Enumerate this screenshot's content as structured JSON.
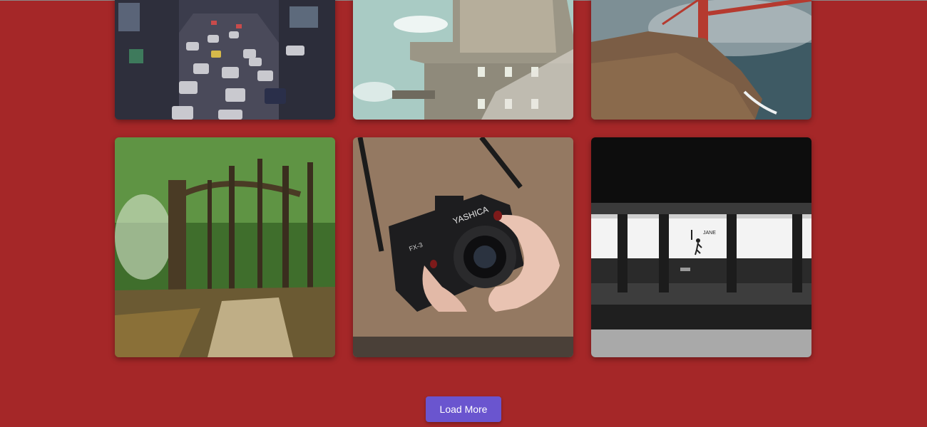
{
  "gallery": {
    "photos": [
      {
        "subject": "city traffic"
      },
      {
        "subject": "concrete tower"
      },
      {
        "subject": "golden gate bridge"
      },
      {
        "subject": "forest path"
      },
      {
        "subject": "camera in hands",
        "camera_text": "YASHICA",
        "model_text": "FX-3"
      },
      {
        "subject": "subway platform",
        "sign_text": "JANE"
      }
    ]
  },
  "load_more": {
    "label": "Load More"
  },
  "colors": {
    "background": "#a52728",
    "button": "#6a55cf",
    "button_text": "#ffffff"
  }
}
